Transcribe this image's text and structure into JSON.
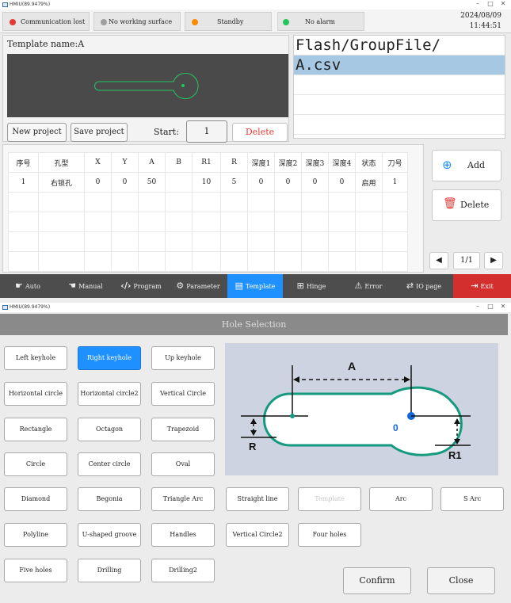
{
  "window1": {
    "title": "HMIU(89.9479%)"
  },
  "status": {
    "items": [
      {
        "label": "Communication lost",
        "dot_color": "#e53935"
      },
      {
        "label": "No working surface",
        "dot_color": "#9e9e9e"
      },
      {
        "label": "Standby",
        "dot_color": "#fb8c00"
      },
      {
        "label": "No alarm",
        "dot_color": "#22c55e"
      }
    ],
    "date": "2024/08/09",
    "time": "11:44:51"
  },
  "template": {
    "name_label": "Template name:",
    "name_value": "A",
    "new_project": "New project",
    "save_project": "Save project",
    "start_label": "Start:",
    "start_value": "1",
    "delete_label": "Delete"
  },
  "files": {
    "rows": [
      "Flash/GroupFile/",
      "A.csv",
      "",
      "",
      "",
      ""
    ],
    "selected_index": 1
  },
  "table": {
    "headers": [
      "序号",
      "孔型",
      "X",
      "Y",
      "A",
      "B",
      "R1",
      "R",
      "深度1",
      "深度2",
      "深度3",
      "深度4",
      "状态",
      "刀号"
    ],
    "rows": [
      [
        "1",
        "右锁孔",
        "0",
        "0",
        "50",
        "",
        "10",
        "5",
        "0",
        "0",
        "0",
        "0",
        "启用",
        "1"
      ]
    ],
    "empty_rows": 4
  },
  "side": {
    "add_label": "Add",
    "delete_label": "Delete",
    "page": "1/1"
  },
  "nav": [
    {
      "label": "Auto",
      "icon": "hand-icon"
    },
    {
      "label": "Manual",
      "icon": "hand-icon"
    },
    {
      "label": "Program",
      "icon": "code-icon"
    },
    {
      "label": "Parameter",
      "icon": "gear-icon"
    },
    {
      "label": "Template",
      "icon": "template-icon"
    },
    {
      "label": "Hinge",
      "icon": "hinge-icon"
    },
    {
      "label": "Error",
      "icon": "error-icon"
    },
    {
      "label": "IO page",
      "icon": "io-icon"
    },
    {
      "label": "Exit",
      "icon": "exit-icon"
    }
  ],
  "window2": {
    "title": "HMIU(89.9479%)"
  },
  "dialog": {
    "title": "Hole Selection",
    "buttons": [
      "Left keyhole",
      "Right keyhole",
      "Up keyhole",
      "Horizontal circle",
      "Horizontal circle2",
      "Vertical Circle",
      "Rectangle",
      "Octagon",
      "Trapezoid",
      "Circle",
      "Center circle",
      "Oval",
      "Diamond",
      "Begonia",
      "Triangle Arc",
      "Straight line",
      "Template",
      "Arc",
      "S Arc",
      "Polyline",
      "U-shaped groove",
      "Handles",
      "Vertical Circle2",
      "Four holes",
      "Five holes",
      "Drilling",
      "Drilling2"
    ],
    "selected": "Right keyhole",
    "disabled": "Template",
    "diagram_labels": {
      "a": "A",
      "r": "R",
      "r1": "R1",
      "origin": "0"
    },
    "confirm": "Confirm",
    "close": "Close"
  },
  "colors": {
    "accent": "#1e90ff",
    "exit": "#d32f2f",
    "nav_bg": "#4d4d4d",
    "delete_text": "#e53935"
  }
}
